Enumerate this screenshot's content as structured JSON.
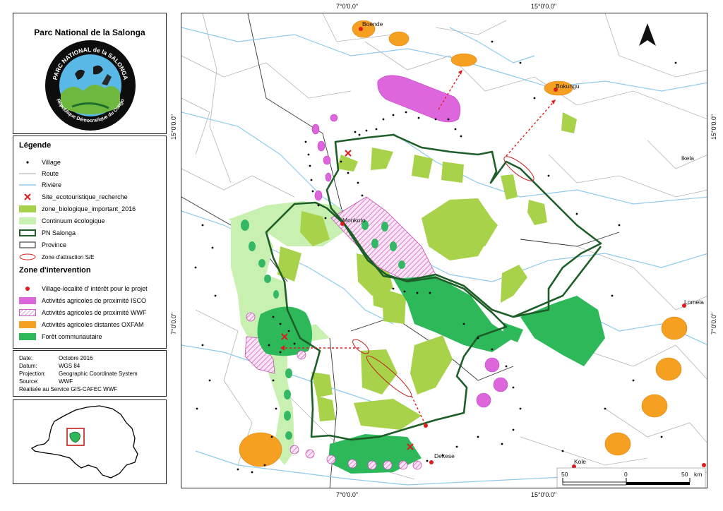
{
  "title": "Parc National de la Salonga",
  "logo": {
    "arc_top": "PARC NATIONAL de la SALONGA",
    "arc_bottom": "République Démocratique du Congo"
  },
  "legend": {
    "heading": "Légende",
    "items": [
      {
        "label": "Village",
        "symbol": "dot-small"
      },
      {
        "label": "Route",
        "symbol": "line-grey"
      },
      {
        "label": "Rivière",
        "symbol": "line-blue"
      },
      {
        "label": "Site_ecotouristique_recherche",
        "symbol": "red-x"
      },
      {
        "label": "zone_biologique_important_2016",
        "symbol": "fill-yellowgreen"
      },
      {
        "label": "Continuum écologique",
        "symbol": "fill-lightgreen"
      },
      {
        "label": "PN Salonga",
        "symbol": "outline-darkgreen"
      },
      {
        "label": "Province",
        "symbol": "outline-black"
      },
      {
        "label": "Zone d'attraction S/E",
        "symbol": "ellipse-red"
      }
    ],
    "intervention_heading": "Zone d'intervention",
    "intervention_items": [
      {
        "label": "Village-localité d' intérêt pour le projet",
        "symbol": "dot-red"
      },
      {
        "label": "Activités agricoles de proximité ISCO",
        "symbol": "fill-magenta"
      },
      {
        "label": "Activités agricoles de proximité WWF",
        "symbol": "hatch-pink"
      },
      {
        "label": "Activités agricoles distantes OXFAM",
        "symbol": "fill-orange"
      },
      {
        "label": "Forêt communautaire",
        "symbol": "fill-darkgreen"
      }
    ]
  },
  "metadata": {
    "rows": [
      {
        "key": "Date:",
        "value": "Octobre 2016"
      },
      {
        "key": "Datum:",
        "value": "WGS 84"
      },
      {
        "key": "Projection:",
        "value": "Geographic Coordinate System"
      },
      {
        "key": "Source:",
        "value": "WWF"
      }
    ],
    "credit": "Réalisée au Service GIS-CAFEC WWF"
  },
  "graticule": {
    "top": [
      "7°0'0.0\"",
      "15°0'0.0\""
    ],
    "bottom": [
      "7°0'0.0\"",
      "15°0'0.0\""
    ],
    "left": [
      "15°0'0.0\"",
      "7°0'0.0\""
    ],
    "right": [
      "15°0'0.0\"",
      "7°0'0.0\""
    ]
  },
  "places": [
    "Boende",
    "Bokungu",
    "Ikela",
    "Monkoto",
    "Lomela",
    "Dekese",
    "Kole"
  ],
  "scale_bar": {
    "labels": [
      "50",
      "0",
      "50"
    ],
    "unit": "km"
  },
  "colors": {
    "isco_magenta": "#dd66dd",
    "oxfam_orange": "#f5a020",
    "forest_dark": "#2db85a",
    "zone_yellowgreen": "#a8d24a",
    "continuum_light": "#c8f0b0",
    "park_border": "#1e5e28",
    "river": "#8ecbeb",
    "road": "#aaaaaa",
    "red": "#dd1c1c"
  }
}
